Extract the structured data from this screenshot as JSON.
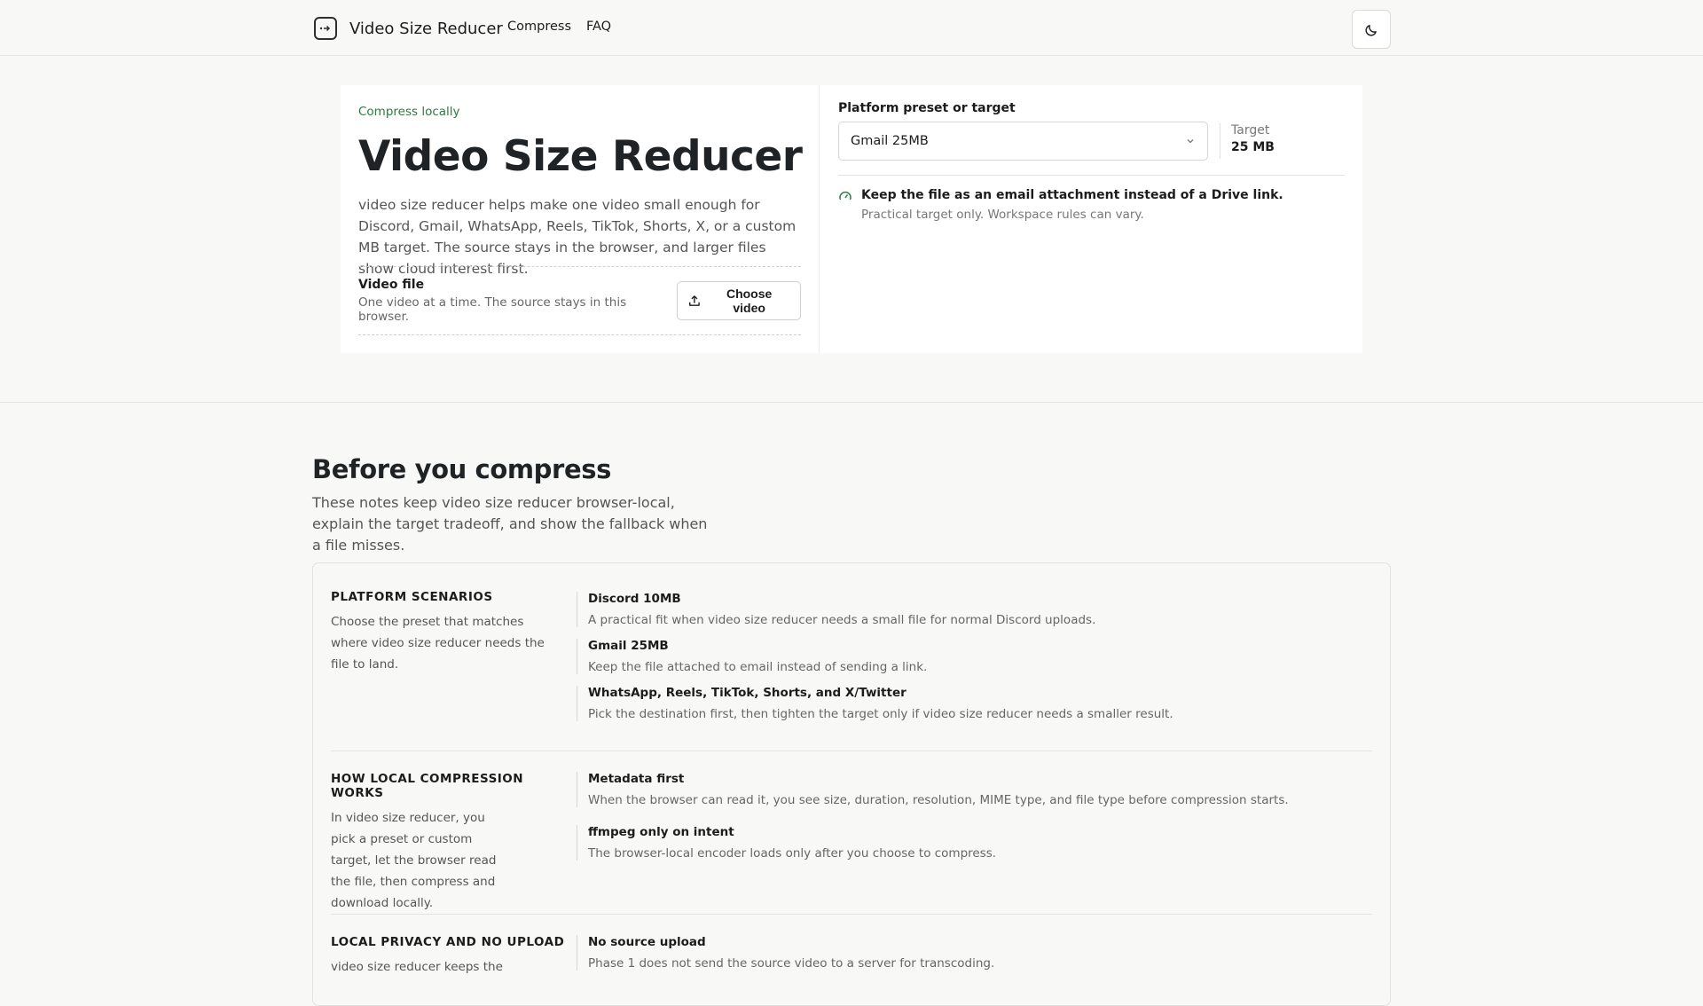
{
  "nav": {
    "brand": "Video Size Reducer",
    "links": [
      "Compress",
      "FAQ"
    ],
    "icons": {
      "brand": "video-icon",
      "theme": "moon-icon"
    }
  },
  "hero": {
    "eyebrow": "Compress locally",
    "title": "Video Size Reducer",
    "description": "video size reducer helps make one video small enough for Discord, Gmail, WhatsApp, Reels, TikTok, Shorts, X, or a custom MB target. The source stays in the browser, and larger files show cloud interest first.",
    "file_label": "Video file",
    "file_sub": "One video at a time. The source stays in this browser.",
    "choose_label": "Choose video"
  },
  "preset": {
    "label": "Platform preset or target",
    "selected": "Gmail 25MB",
    "target_label": "Target",
    "target_value": "25 MB",
    "note_title": "Keep the file as an email attachment instead of a Drive link.",
    "note_sub": "Practical target only. Workspace rules can vary."
  },
  "section": {
    "title": "Before you compress",
    "description": "These notes keep video size reducer browser-local, explain the target tradeoff, and show the fallback when a file misses."
  },
  "groups": [
    {
      "title": "PLATFORM SCENARIOS",
      "description": "Choose the preset that matches where video size reducer needs the file to land.",
      "items": [
        {
          "title": "Discord 10MB",
          "description": "A practical fit when video size reducer needs a small file for normal Discord uploads."
        },
        {
          "title": "Gmail 25MB",
          "description": "Keep the file attached to email instead of sending a link."
        },
        {
          "title": "WhatsApp, Reels, TikTok, Shorts, and X/Twitter",
          "description": "Pick the destination first, then tighten the target only if video size reducer needs a smaller result."
        }
      ]
    },
    {
      "title": "HOW LOCAL COMPRESSION WORKS",
      "description": "In video size reducer, you pick a preset or custom target, let the browser read the file, then compress and download locally.",
      "items": [
        {
          "title": "Metadata first",
          "description": "When the browser can read it, you see size, duration, resolution, MIME type, and file type before compression starts."
        },
        {
          "title": "ffmpeg only on intent",
          "description": "The browser-local encoder loads only after you choose to compress."
        }
      ]
    },
    {
      "title": "LOCAL PRIVACY AND NO UPLOAD",
      "description": "video size reducer keeps the",
      "items": [
        {
          "title": "No source upload",
          "description": "Phase 1 does not send the source video to a server for transcoding."
        }
      ]
    }
  ]
}
